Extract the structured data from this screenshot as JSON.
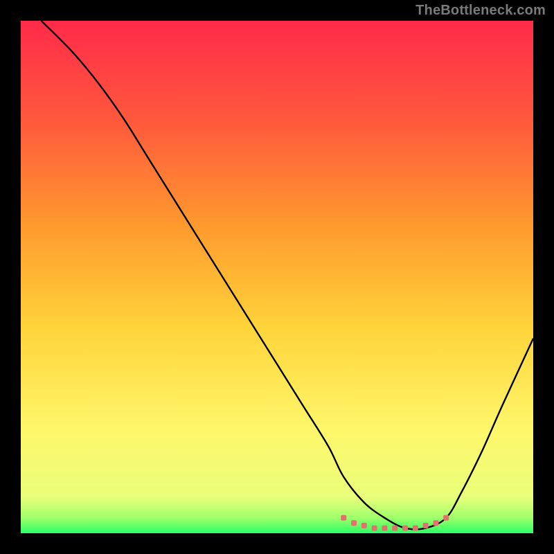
{
  "watermark": "TheBottleneck.com",
  "chart_data": {
    "type": "line",
    "title": "",
    "xlabel": "",
    "ylabel": "",
    "xlim": [
      0,
      100
    ],
    "ylim": [
      0,
      100
    ],
    "series": [
      {
        "name": "black-curve",
        "color": "#000000",
        "x": [
          4,
          10,
          15,
          20,
          25,
          30,
          35,
          40,
          45,
          50,
          55,
          60,
          63,
          67,
          71,
          75,
          79,
          83,
          86,
          90,
          94,
          100
        ],
        "values": [
          100,
          94,
          88,
          81,
          73,
          65,
          57,
          49,
          41,
          33,
          25,
          17,
          11,
          6,
          3,
          1,
          1,
          3,
          8,
          16,
          25,
          38
        ]
      },
      {
        "name": "flat-zone-dots",
        "color": "#e4716c",
        "x": [
          63,
          65,
          67,
          69,
          71,
          73,
          75,
          77,
          79,
          81,
          83
        ],
        "values": [
          3,
          2,
          1.5,
          1,
          1,
          1,
          1,
          1,
          1.5,
          2,
          3
        ]
      }
    ],
    "background_gradient": {
      "stops": [
        {
          "pos": 0.0,
          "color": "#ff2a4a"
        },
        {
          "pos": 0.2,
          "color": "#ff5a3c"
        },
        {
          "pos": 0.4,
          "color": "#ff9a2e"
        },
        {
          "pos": 0.6,
          "color": "#ffd43a"
        },
        {
          "pos": 0.8,
          "color": "#fff76b"
        },
        {
          "pos": 0.93,
          "color": "#e9ff7a"
        },
        {
          "pos": 0.97,
          "color": "#9fff6a"
        },
        {
          "pos": 1.0,
          "color": "#2bff66"
        }
      ]
    }
  }
}
